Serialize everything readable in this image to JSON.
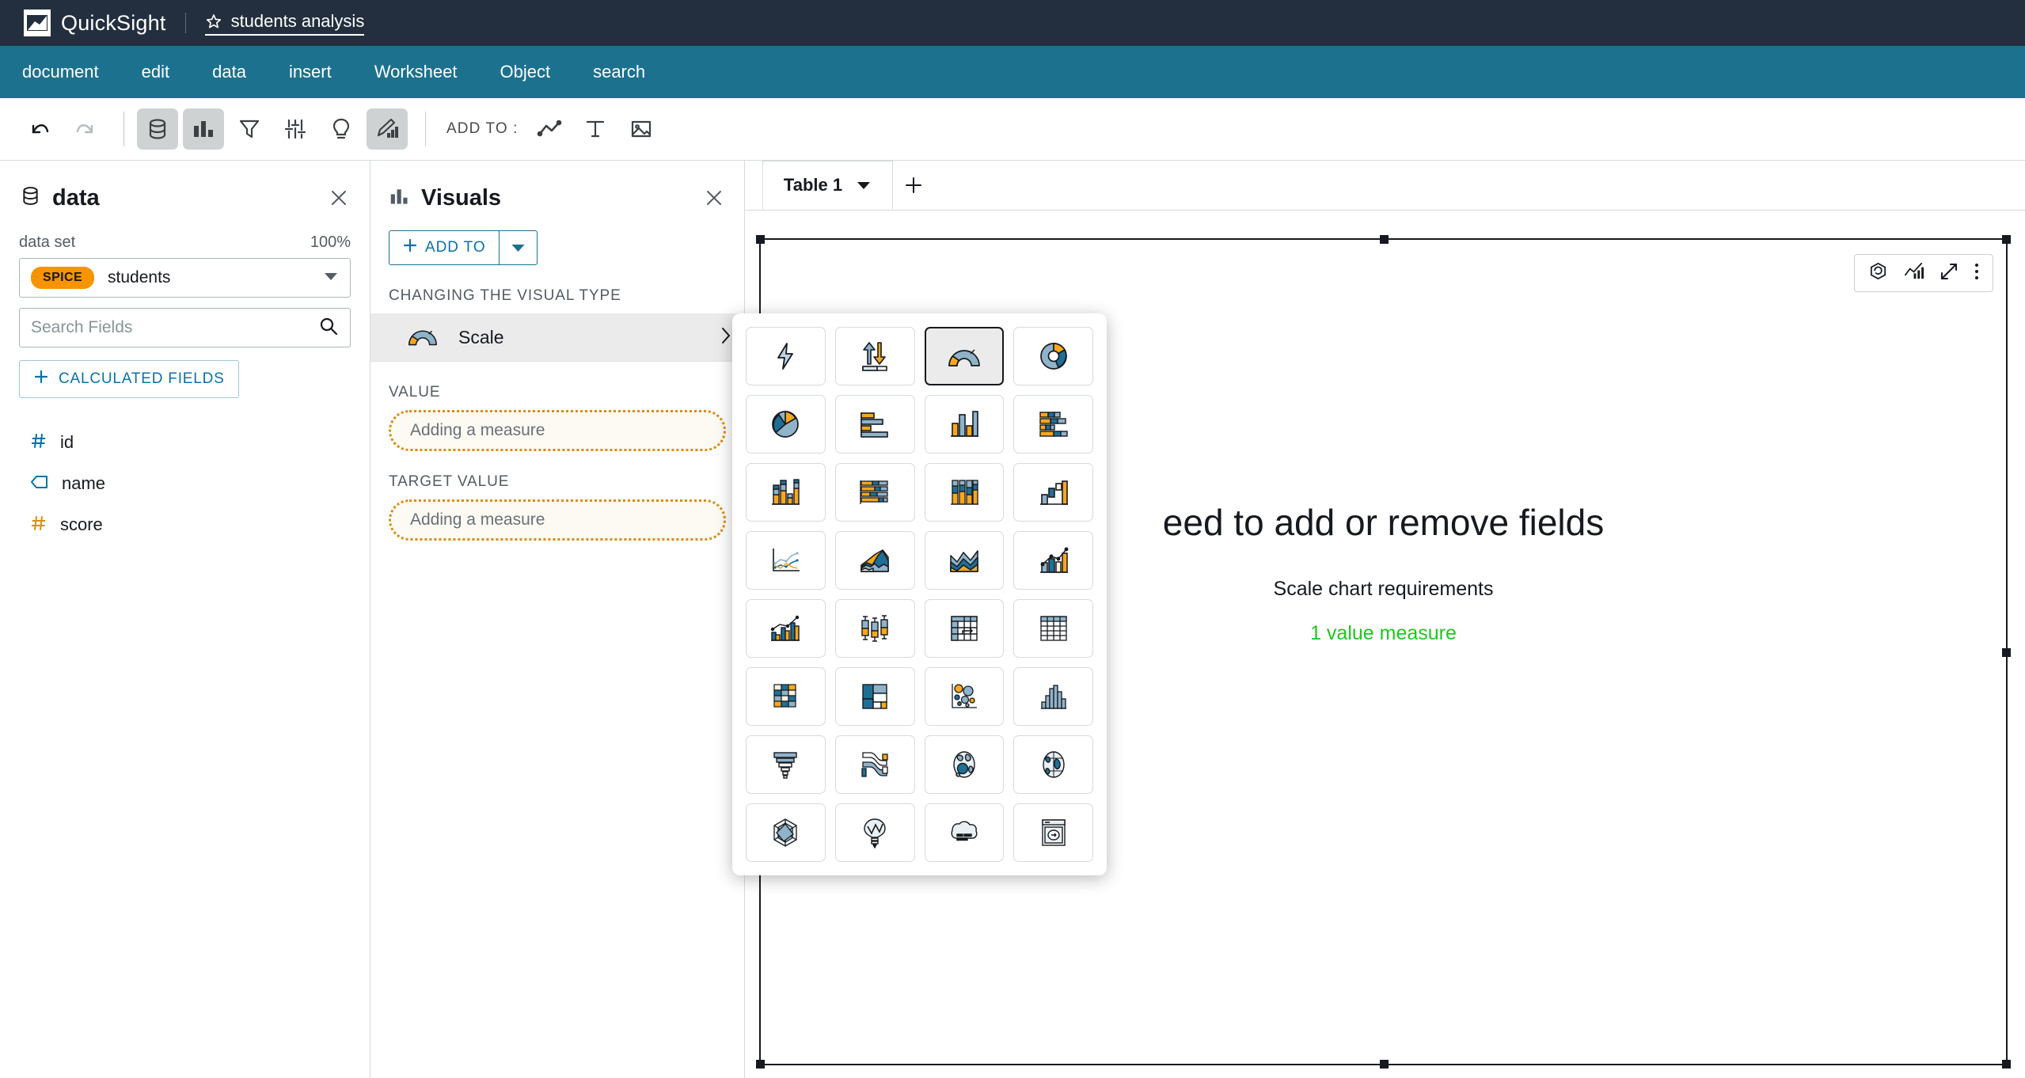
{
  "topbar": {
    "logo_icon": "quicksight-logo-icon",
    "brand": "QuickSight",
    "favorite_icon": "star-outline-icon",
    "document_title": "students analysis"
  },
  "menubar": {
    "items": [
      {
        "label": "document"
      },
      {
        "label": "edit"
      },
      {
        "label": "data"
      },
      {
        "label": "insert"
      },
      {
        "label": "Worksheet"
      },
      {
        "label": "Object"
      },
      {
        "label": "search"
      }
    ]
  },
  "toolbar": {
    "undo_icon": "undo-icon",
    "redo_icon": "redo-icon",
    "data_icon": "database-icon",
    "visuals_icon": "bar-chart-icon",
    "filter_icon": "filter-icon",
    "parameters_icon": "sliders-icon",
    "insights_icon": "lightbulb-icon",
    "format_icon": "edit-chart-icon",
    "add_to_label": "ADD TO :",
    "add_line_icon": "line-chart-icon",
    "add_text_icon": "text-icon",
    "add_image_icon": "image-icon"
  },
  "data_panel": {
    "icon": "database-icon",
    "title": "data",
    "close_icon": "close-icon",
    "dataset_label": "data set",
    "percent": "100%",
    "spice_badge": "SPICE",
    "dataset_name": "students",
    "dropdown_icon": "caret-down-icon",
    "search_placeholder": "Search Fields",
    "search_value": "",
    "search_icon": "search-icon",
    "calculated_fields_label": "CALCULATED FIELDS",
    "plus_icon": "plus-icon",
    "fields": [
      {
        "name": "id",
        "type": "number",
        "icon": "hash-icon",
        "color": "#0972a7"
      },
      {
        "name": "name",
        "type": "string",
        "icon": "tag-icon",
        "color": "#0972a7"
      },
      {
        "name": "score",
        "type": "measure",
        "icon": "hash-icon",
        "color": "#d98d13"
      }
    ]
  },
  "visuals_panel": {
    "icon": "bar-chart-icon",
    "title": "Visuals",
    "close_icon": "close-icon",
    "add_to_label": "ADD TO",
    "add_to_plus_icon": "plus-icon",
    "add_to_caret_icon": "caret-down-icon",
    "section_caption": "CHANGING THE VISUAL TYPE",
    "visual_type_name": "Scale",
    "visual_type_icon": "gauge-icon",
    "visual_type_chevron": "chevron-right-icon",
    "wells": [
      {
        "label": "VALUE",
        "placeholder": "Adding a measure"
      },
      {
        "label": "TARGET VALUE",
        "placeholder": "Adding a measure"
      }
    ]
  },
  "canvas": {
    "tab_label": "Table 1",
    "tab_caret_icon": "caret-down-icon",
    "add_tab_icon": "plus-icon",
    "visual_menu_icons": [
      "refresh-icon",
      "chart-icon",
      "expand-icon",
      "kebab-menu-icon"
    ],
    "empty_title": "eed to add or remove fields",
    "empty_subtitle": "Scale chart requirements",
    "empty_requirement": "1 value measure",
    "requirement_color": "#1ec81e"
  },
  "visual_type_picker": {
    "selected": "gauge",
    "items": [
      {
        "id": "autograph",
        "label": "AutoGraph"
      },
      {
        "id": "kpi",
        "label": "KPI"
      },
      {
        "id": "gauge",
        "label": "Gauge"
      },
      {
        "id": "donut",
        "label": "Donut chart"
      },
      {
        "id": "pie",
        "label": "Pie chart"
      },
      {
        "id": "horizontal-bar",
        "label": "Horizontal bar chart"
      },
      {
        "id": "vertical-bar",
        "label": "Vertical bar chart"
      },
      {
        "id": "h-stacked-bar",
        "label": "Horizontal stacked bar chart"
      },
      {
        "id": "v-stacked-bar",
        "label": "Vertical stacked bar chart"
      },
      {
        "id": "h-stacked-100",
        "label": "Horizontal stacked 100% bar chart"
      },
      {
        "id": "v-stacked-100",
        "label": "Vertical stacked 100% bar chart"
      },
      {
        "id": "waterfall",
        "label": "Waterfall chart"
      },
      {
        "id": "line",
        "label": "Line chart"
      },
      {
        "id": "area-line",
        "label": "Area line chart"
      },
      {
        "id": "stacked-area",
        "label": "Stacked area chart"
      },
      {
        "id": "combo",
        "label": "Combo chart"
      },
      {
        "id": "clustered-combo",
        "label": "Clustered combo chart"
      },
      {
        "id": "box-plot",
        "label": "Box plot"
      },
      {
        "id": "pivot-table",
        "label": "Pivot table"
      },
      {
        "id": "table",
        "label": "Table"
      },
      {
        "id": "heat-map",
        "label": "Heat map"
      },
      {
        "id": "tree-map",
        "label": "Tree map"
      },
      {
        "id": "scatter-plot",
        "label": "Scatter plot"
      },
      {
        "id": "histogram",
        "label": "Histogram"
      },
      {
        "id": "funnel",
        "label": "Funnel chart"
      },
      {
        "id": "sankey",
        "label": "Sankey diagram"
      },
      {
        "id": "filled-map",
        "label": "Filled map"
      },
      {
        "id": "points-on-map",
        "label": "Points on map"
      },
      {
        "id": "radar",
        "label": "Radar chart"
      },
      {
        "id": "word-cloud",
        "label": "Word cloud"
      },
      {
        "id": "insight",
        "label": "Insight"
      },
      {
        "id": "custom-visual",
        "label": "Custom visual content"
      }
    ]
  }
}
